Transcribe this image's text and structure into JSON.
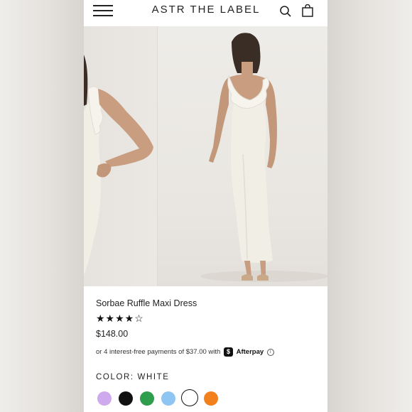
{
  "header": {
    "brand": "ASTR THE LABEL",
    "menu_icon": "hamburger-menu-icon",
    "search_icon": "search-icon",
    "bag_icon": "shopping-bag-icon"
  },
  "product": {
    "title": "Sorbae Ruffle Maxi Dress",
    "rating": 4.5,
    "rating_max": 5,
    "stars_display": "★★★★☆",
    "price": "$148.00",
    "afterpay": {
      "text_before": "or 4 interest-free payments of $37.00 with",
      "logo_glyph": "$",
      "brand": "Afterpay",
      "info_glyph": "i"
    },
    "color_label": "COLOR:",
    "color_value": "WHITE",
    "swatches": [
      {
        "color": "#cfa9ee"
      },
      {
        "color": "#111111"
      },
      {
        "color": "#2e9d4c"
      },
      {
        "color": "#8fc5f2"
      },
      {
        "color": "#ffffff",
        "selected": true
      },
      {
        "color": "#f2811d"
      }
    ]
  },
  "colors": {
    "dress": "#f1eee6",
    "skin": "#c99e80",
    "hair": "#3a2d26",
    "text": "#222222"
  }
}
